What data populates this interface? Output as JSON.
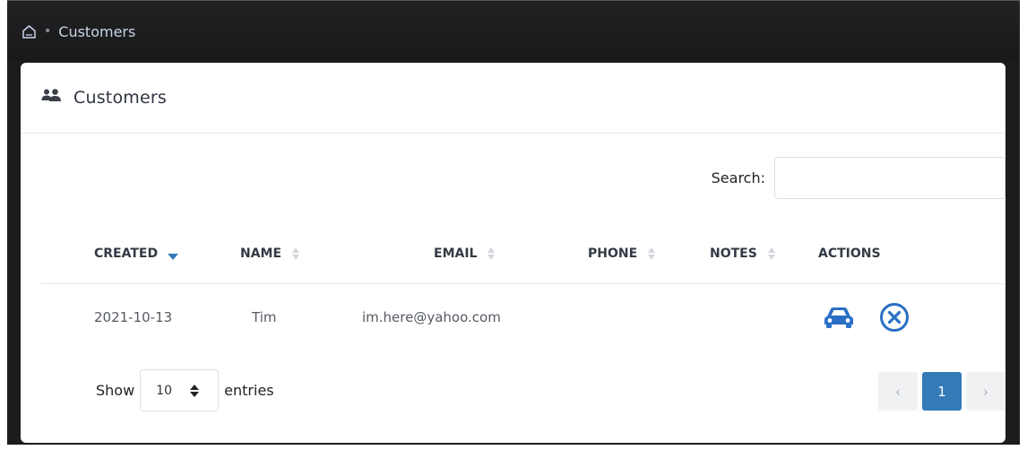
{
  "breadcrumb": {
    "home_icon": "home-icon",
    "current": "Customers"
  },
  "card": {
    "title": "Customers",
    "title_icon": "users-icon"
  },
  "search": {
    "label": "Search:",
    "value": "",
    "placeholder": ""
  },
  "table": {
    "columns": [
      "CREATED",
      "NAME",
      "EMAIL",
      "PHONE",
      "NOTES",
      "ACTIONS"
    ],
    "sorted_column": "CREATED",
    "sort_direction": "desc",
    "rows": [
      {
        "created": "2021-10-13",
        "name": "Tim",
        "email": "im.here@yahoo.com",
        "phone": "",
        "notes": ""
      }
    ],
    "row_actions": [
      "car-icon",
      "close-circle-icon"
    ]
  },
  "length": {
    "show_label": "Show",
    "value": "10",
    "entries_label": "entries"
  },
  "pagination": {
    "prev": "‹",
    "current": "1",
    "next": "›"
  },
  "colors": {
    "accent": "#337ab7",
    "action_icon": "#2a6fc4",
    "sort_active": "#337ab7",
    "topbar": "#1c1c1e"
  }
}
